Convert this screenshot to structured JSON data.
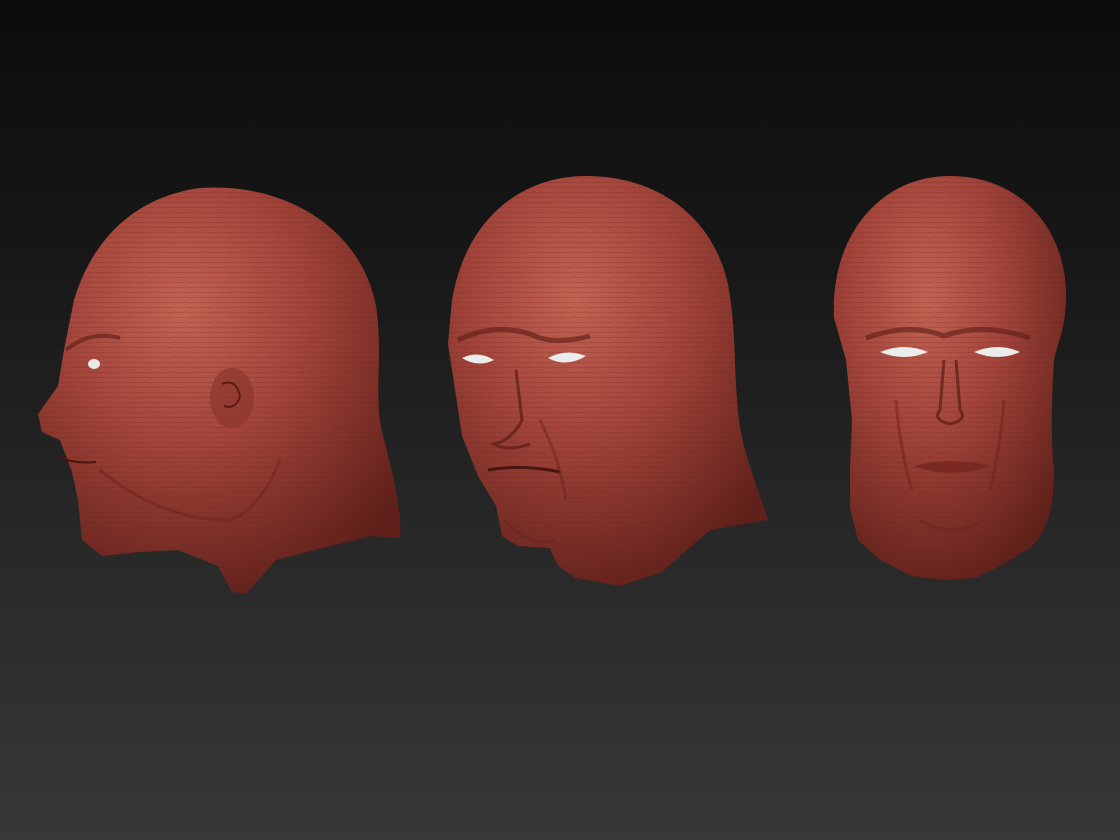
{
  "scene": {
    "kind": "3D sculpt render (ZBrush-style)",
    "background": {
      "top": "#0c0c0c",
      "bottom": "#383838"
    },
    "material_color": "#a2443a",
    "eye_color": "#e8e8e8",
    "views": [
      {
        "id": "side",
        "name": "left-profile-view"
      },
      {
        "id": "three_quarter",
        "name": "three-quarter-view"
      },
      {
        "id": "front",
        "name": "front-view"
      }
    ]
  }
}
